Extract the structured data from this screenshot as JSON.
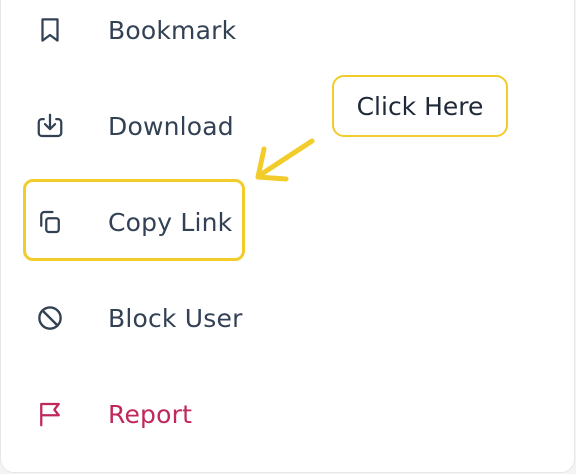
{
  "menu": {
    "items": [
      {
        "label": "Bookmark",
        "icon": "bookmark-icon"
      },
      {
        "label": "Download",
        "icon": "download-icon"
      },
      {
        "label": "Copy Link",
        "icon": "copy-icon"
      },
      {
        "label": "Block User",
        "icon": "block-icon"
      },
      {
        "label": "Report",
        "icon": "flag-icon"
      }
    ]
  },
  "annotation": {
    "callout_text": "Click Here"
  },
  "colors": {
    "text": "#334155",
    "danger": "#c0275d",
    "highlight": "#f2cc2a"
  }
}
